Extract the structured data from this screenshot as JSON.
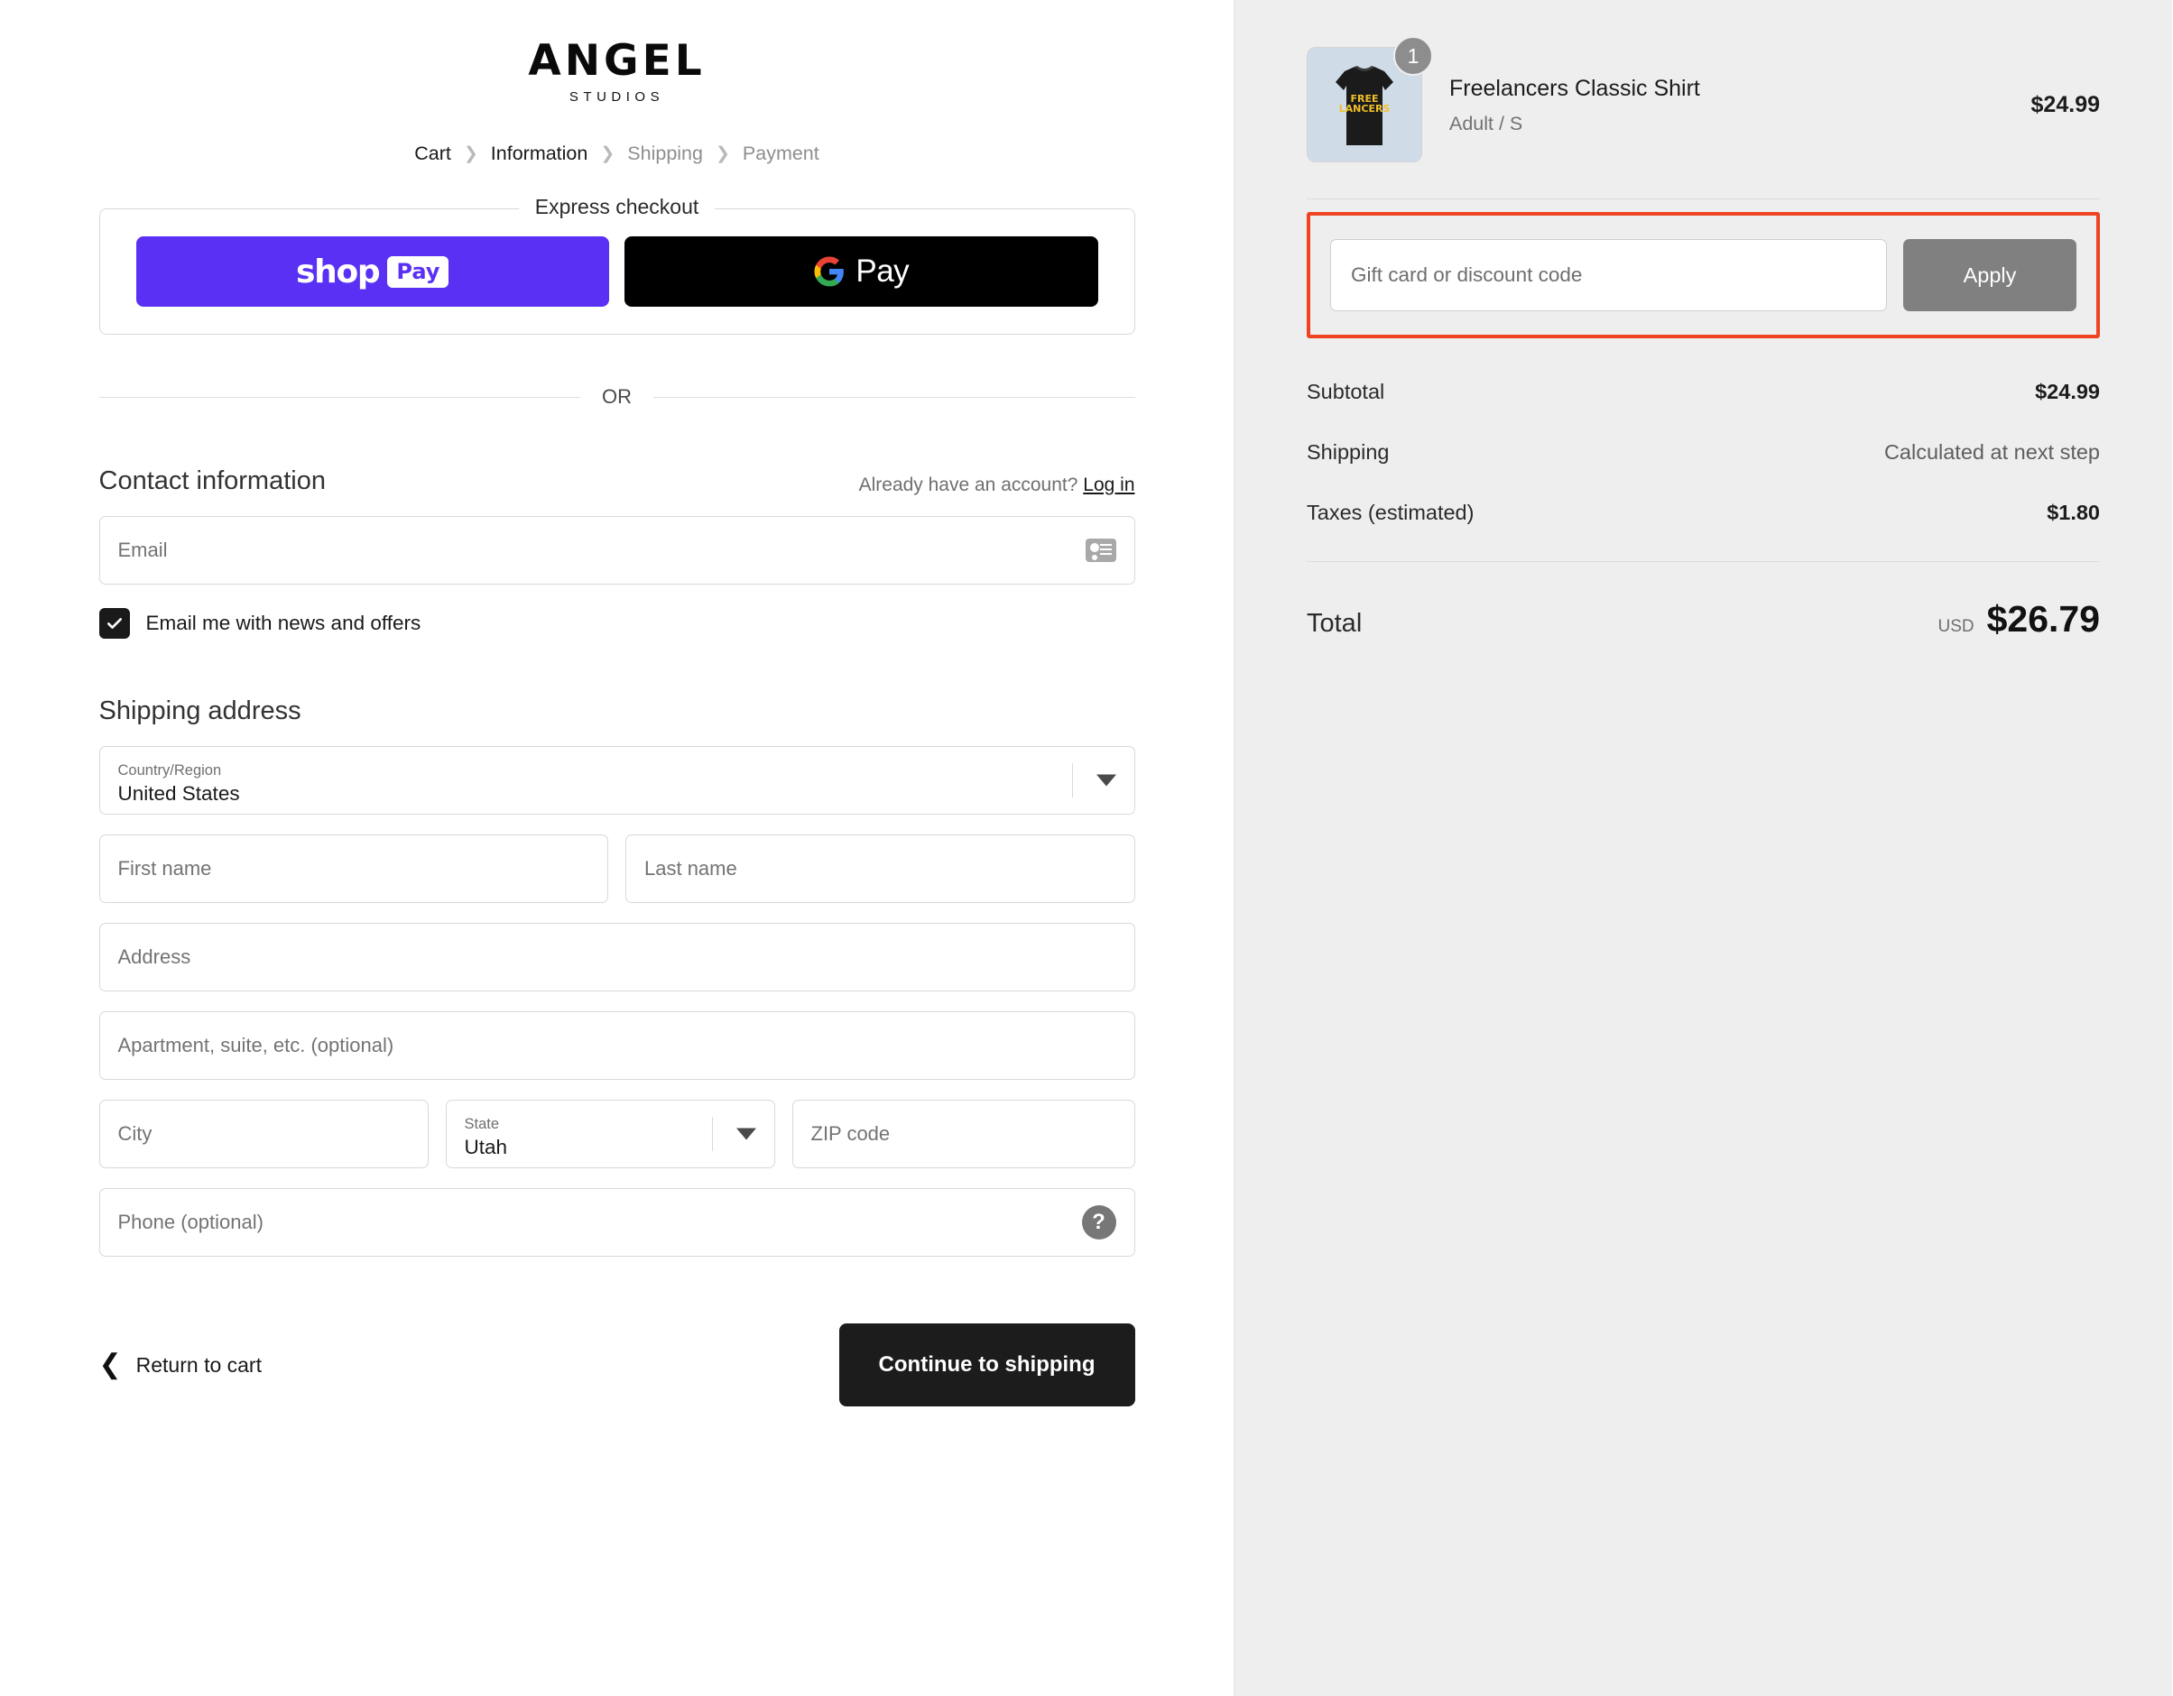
{
  "brand": {
    "name": "ANGEL",
    "sub": "STUDIOS"
  },
  "breadcrumb": [
    {
      "label": "Cart",
      "active": true
    },
    {
      "label": "Information",
      "active": true
    },
    {
      "label": "Shipping",
      "active": false
    },
    {
      "label": "Payment",
      "active": false
    }
  ],
  "express": {
    "legend": "Express checkout",
    "shop_pay": {
      "word": "shop",
      "chip": "Pay"
    },
    "google_pay": {
      "text": "Pay"
    },
    "or": "OR"
  },
  "contact": {
    "title": "Contact information",
    "account_prompt": "Already have an account?",
    "login_label": "Log in",
    "email_placeholder": "Email",
    "newsletter_label": "Email me with news and offers",
    "newsletter_checked": true
  },
  "shipping": {
    "title": "Shipping address",
    "country_label": "Country/Region",
    "country_value": "United States",
    "first_name_placeholder": "First name",
    "last_name_placeholder": "Last name",
    "address_placeholder": "Address",
    "apartment_placeholder": "Apartment, suite, etc. (optional)",
    "city_placeholder": "City",
    "state_label": "State",
    "state_value": "Utah",
    "zip_placeholder": "ZIP code",
    "phone_placeholder": "Phone (optional)",
    "help_icon": "?"
  },
  "actions": {
    "return_label": "Return to cart",
    "continue_label": "Continue to shipping"
  },
  "order": {
    "product": {
      "name": "Freelancers Classic Shirt",
      "variant": "Adult / S",
      "price": "$24.99",
      "quantity": "1",
      "art_line1": "FREE",
      "art_line2": "LANCERS"
    },
    "discount": {
      "placeholder": "Gift card or discount code",
      "apply_label": "Apply",
      "highlight_color": "#ef4423"
    },
    "lines": [
      {
        "label": "Subtotal",
        "value": "$24.99",
        "muted": false
      },
      {
        "label": "Shipping",
        "value": "Calculated at next step",
        "muted": true
      },
      {
        "label": "Taxes (estimated)",
        "value": "$1.80",
        "muted": false
      }
    ],
    "total": {
      "label": "Total",
      "currency": "USD",
      "amount": "$26.79"
    }
  }
}
